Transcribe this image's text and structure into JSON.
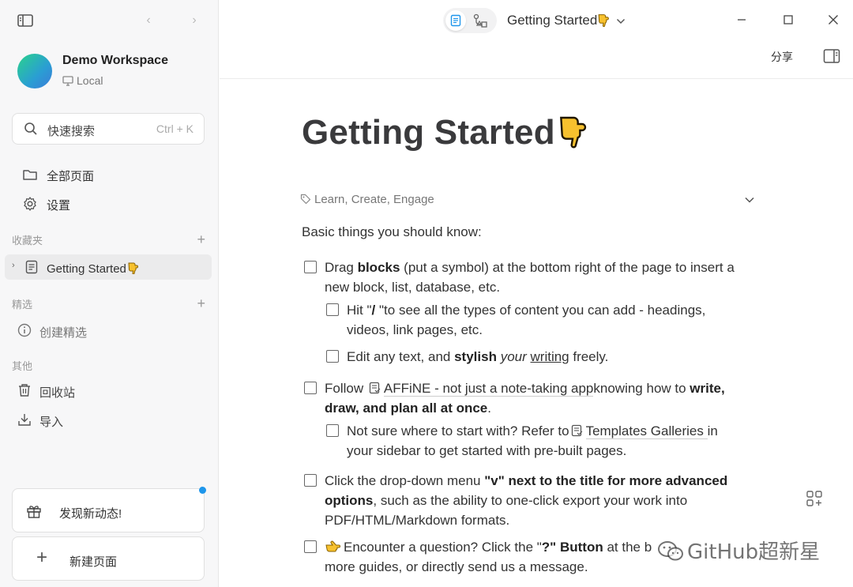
{
  "sidebar": {
    "workspace": {
      "name": "Demo Workspace",
      "location": "Local"
    },
    "search": {
      "label": "快速搜索",
      "shortcut": "Ctrl + K"
    },
    "nav": [
      {
        "label": "全部页面",
        "icon": "folder-icon"
      },
      {
        "label": "设置",
        "icon": "gear-icon"
      }
    ],
    "favorites": {
      "title": "收藏夹",
      "items": [
        {
          "label": "Getting Started"
        }
      ]
    },
    "collections": {
      "title": "精选",
      "create_label": "创建精选"
    },
    "others": {
      "title": "其他",
      "trash_label": "回收站",
      "import_label": "导入"
    },
    "whats_new_label": "发现新动态!",
    "new_page_label": "新建页面"
  },
  "header": {
    "doc_title": "Getting Started",
    "share_label": "分享"
  },
  "document": {
    "title": "Getting Started",
    "tags": "Learn, Create, Engage",
    "intro": "Basic things you should know:",
    "todo1": {
      "a": "Drag ",
      "b": "blocks",
      "c": " (put a symbol) at the bottom right of the page to insert a",
      "line2": "new block, list, database, etc."
    },
    "todo1a": {
      "a": "Hit \"",
      "b": "/",
      "c": " \"to see all the types of content you can add - headings,",
      "line2": "videos, link pages, etc."
    },
    "todo1b": {
      "a": "Edit any text, and ",
      "b": "stylish",
      "c": " ",
      "d": "your",
      "e": " ",
      "f": "writing",
      "g": " freely."
    },
    "todo2": {
      "a": "Follow ",
      "link": "AFFiNE - not just a note-taking app",
      "c": "knowing how to ",
      "d": "write,",
      "line2b": "draw, and plan all at once",
      "line2c": "."
    },
    "todo2a": {
      "a": "Not sure where to start with? Refer to",
      "link": "Templates Galleries ",
      "c": " in",
      "line2": "your sidebar to get started with pre-built pages."
    },
    "todo3": {
      "a": "Click the drop-down menu ",
      "b": "\"v\" next to the title for more advanced",
      "line2b": "options",
      "line2c": ", such as the ability to one-click export your work into",
      "line3": "PDF/HTML/Markdown formats."
    },
    "todo4": {
      "a": "Encounter a question?  Click the \"",
      "b": "?\" Button",
      "c": " at the b",
      "line2": "more guides, or directly send us a message."
    }
  },
  "watermark": "GitHub超新星",
  "colors": {
    "accent": "#1e96eb",
    "sidebar_bg": "#f7f7f8",
    "text": "#333333"
  }
}
